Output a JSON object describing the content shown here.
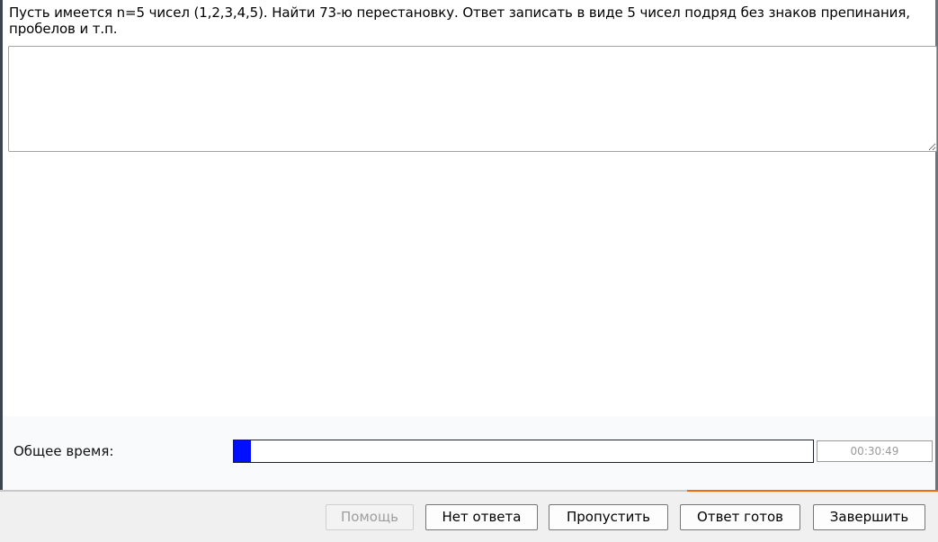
{
  "question": {
    "text": "Пусть имеется n=5 чисел (1,2,3,4,5). Найти 73-ю перестановку. Ответ записать в виде 5 чисел подряд без знаков препинания, пробелов и т.п."
  },
  "answer": {
    "value": ""
  },
  "timer": {
    "label": "Общее время:",
    "value": "00:30:49",
    "progress_fraction": 0.03,
    "fill_color": "#0010ff"
  },
  "buttons": {
    "help": "Помощь",
    "no_answer": "Нет ответа",
    "skip": "Пропустить",
    "answer_ready": "Ответ готов",
    "finish": "Завершить"
  },
  "accent_color": "#ee6a10"
}
